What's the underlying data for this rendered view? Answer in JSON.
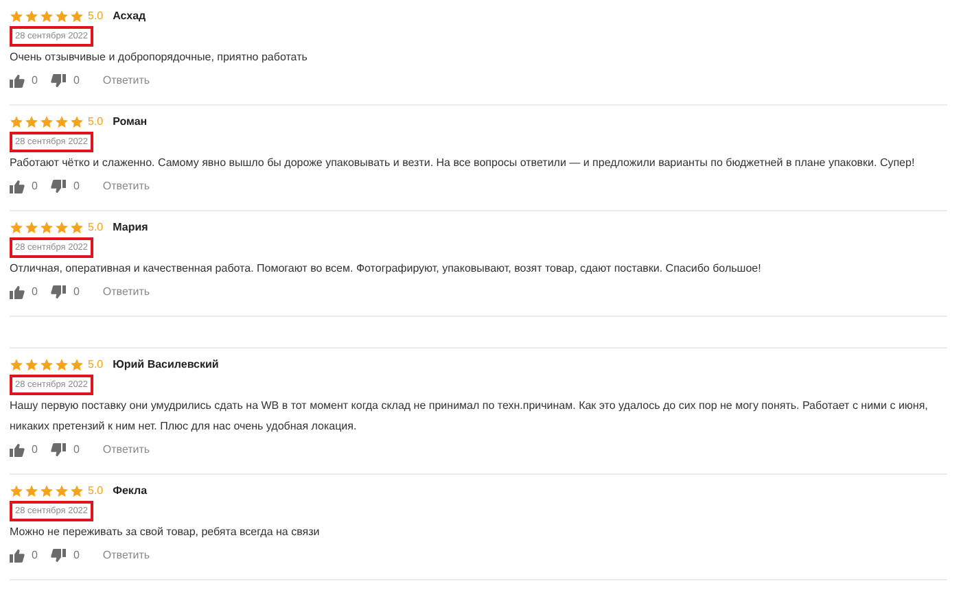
{
  "feed": [
    {
      "kind": "review",
      "stars": 5,
      "rating": "5.0",
      "author": "Асхад",
      "date": "28 сентября 2022",
      "date_highlighted": true,
      "text": "Очень отзывчивые и добропорядочные, приятно работать",
      "likes": "0",
      "dislikes": "0",
      "reply": "Ответить"
    },
    {
      "kind": "review",
      "stars": 5,
      "rating": "5.0",
      "author": "Роман",
      "date": "28 сентября 2022",
      "date_highlighted": true,
      "text": "Работают чётко и слаженно. Самому явно вышло бы дороже упаковывать и везти. На все вопросы ответили — и предложили варианты по бюджетней в плане упаковки. Супер!",
      "likes": "0",
      "dislikes": "0",
      "reply": "Ответить"
    },
    {
      "kind": "review",
      "stars": 5,
      "rating": "5.0",
      "author": "Мария",
      "date": "28 сентября 2022",
      "date_highlighted": true,
      "text": "Отличная, оперативная и качественная работа. Помогают во всем. Фотографируют, упаковывают, возят товар, сдают поставки. Спасибо большое!",
      "likes": "0",
      "dislikes": "0",
      "reply": "Ответить"
    },
    {
      "kind": "empty"
    },
    {
      "kind": "review",
      "stars": 5,
      "rating": "5.0",
      "author": "Юрий Василевский",
      "date": "28 сентября 2022",
      "date_highlighted": true,
      "text": "Нашу первую поставку они умудрились сдать на WB в тот момент когда склад не принимал по техн.причинам. Как это удалось до сих пор не могу понять. Работает с ними с июня, никаких претензий к ним нет. Плюс для нас очень удобная локация.",
      "likes": "0",
      "dislikes": "0",
      "reply": "Ответить"
    },
    {
      "kind": "review",
      "stars": 5,
      "rating": "5.0",
      "author": "Фекла",
      "date": "28 сентября 2022",
      "date_highlighted": true,
      "text": "Можно не переживать за свой товар, ребята всегда на связи",
      "likes": "0",
      "dislikes": "0",
      "reply": "Ответить"
    }
  ]
}
